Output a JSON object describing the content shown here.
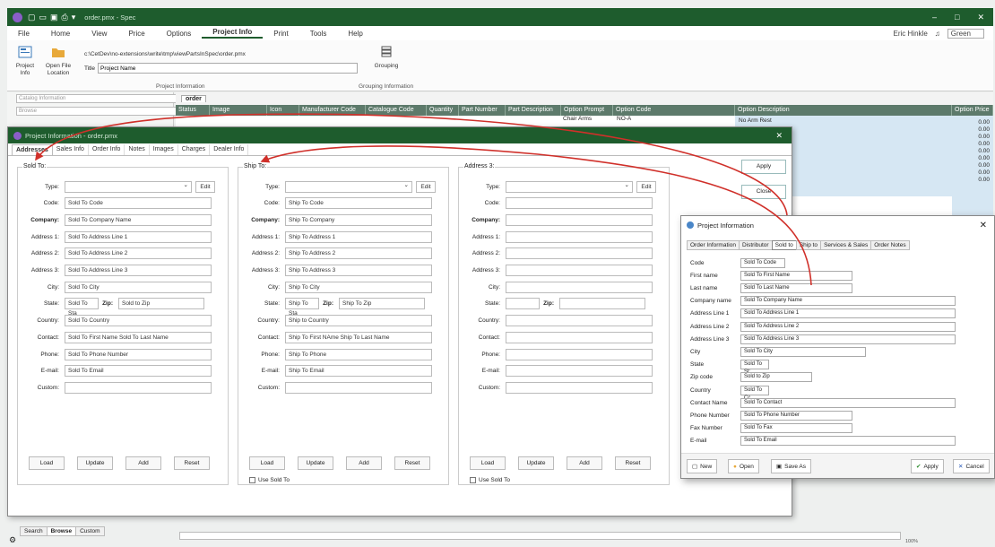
{
  "app": {
    "title": "order.pmx - Spec"
  },
  "menu": {
    "items": [
      "File",
      "Home",
      "View",
      "Price",
      "Options",
      "Project Info",
      "Print",
      "Tools",
      "Help"
    ],
    "active": "Project Info"
  },
  "user": {
    "name": "Eric Hinkle",
    "theme": "Green"
  },
  "ribbon": {
    "project_info": "Project\nInfo",
    "open_file": "Open File\nLocation",
    "path": "c:\\CetDev\\no-extensions\\write\\tmp\\viewPartsInSpec\\order.pmx",
    "title_label": "Title",
    "title_value": "Project Name",
    "grouping": "Grouping",
    "group_project": "Project Information",
    "group_grouping": "Grouping Information"
  },
  "left": {
    "catalog": "Catalog Information",
    "browse": "Browse"
  },
  "grid": {
    "tab": "order",
    "columns": [
      "Status",
      "Image",
      "Icon",
      "Manufacturer Code",
      "Catalogue Code",
      "Quantity",
      "Part Number",
      "Part Description",
      "Option Prompt",
      "Option Code",
      "Option Description",
      "Option Price"
    ],
    "row_prompt": "Chair Arms",
    "row_code": "NO-A",
    "row_desc": "No Arm Rest",
    "prices": [
      "0.00",
      "0.00",
      "0.00",
      "0.00",
      "0.00",
      "0.00",
      "0.00",
      "0.00",
      "0.00"
    ]
  },
  "dialog": {
    "title": "Project Information - order.pmx",
    "tabs": [
      "Addresses",
      "Sales Info",
      "Order Info",
      "Notes",
      "Images",
      "Charges",
      "Dealer Info"
    ],
    "apply": "Apply",
    "close": "Close",
    "labels": {
      "type": "Type:",
      "code": "Code:",
      "company": "Company:",
      "a1": "Address 1:",
      "a2": "Address 2:",
      "a3": "Address 3:",
      "city": "City:",
      "state": "State:",
      "zip": "Zip:",
      "country": "Country:",
      "contact": "Contact:",
      "phone": "Phone:",
      "email": "E-mail:",
      "custom": "Custom:"
    },
    "edit": "Edit",
    "load": "Load",
    "update": "Update",
    "add": "Add",
    "reset": "Reset",
    "use_sold_to": "Use Sold To",
    "sold": {
      "title": "Sold To:",
      "code": "Sold To Code",
      "company": "Sold To Company Name",
      "a1": "Sold To Address Line 1",
      "a2": "Sold To Address Line 2",
      "a3": "Sold To Address Line 3",
      "city": "Sold To City",
      "state": "Sold To Sta",
      "zip": "Sold to Zip",
      "country": "Sold To Country",
      "contact": "Sold To First Name Sold To Last Name",
      "phone": "Sold To Phone Number",
      "email": "Sold To Email"
    },
    "ship": {
      "title": "Ship To:",
      "code": "Ship To Code",
      "company": "Ship To Company",
      "a1": "Ship To Address 1",
      "a2": "Ship To Address 2",
      "a3": "Ship To Address 3",
      "city": "Ship To City",
      "state": "Ship To Sta",
      "zip": "Ship To Zip",
      "country": "Ship to Country",
      "contact": "Ship To First NAme Ship To Last Name",
      "phone": "Ship To Phone",
      "email": "Ship To Email"
    },
    "addr3": {
      "title": "Address 3:"
    }
  },
  "dialog2": {
    "title": "Project Information",
    "tabs": [
      "Order Information",
      "Distributor",
      "Sold to",
      "Ship to",
      "Services & Sales",
      "Order Notes"
    ],
    "rows": [
      [
        "Code",
        "Sold To Code"
      ],
      [
        "First name",
        "Sold To First Name"
      ],
      [
        "Last name",
        "Sold To Last Name"
      ],
      [
        "Company name",
        "Sold To Company Name"
      ],
      [
        "Address Line 1",
        "Sold To Address Line 1"
      ],
      [
        "Address Line 2",
        "Sold To Address Line 2"
      ],
      [
        "Address Line 3",
        "Sold To Address Line 3"
      ],
      [
        "City",
        "Sold To City"
      ],
      [
        "State",
        "Sold To St:"
      ],
      [
        "Zip code",
        "Sold to Zip"
      ],
      [
        "Country",
        "Sold To Cc"
      ],
      [
        "Contact Name",
        "Sold To Contact"
      ],
      [
        "Phone Number",
        "Sold To Phone Number"
      ],
      [
        "Fax Number",
        "Sold To Fax"
      ],
      [
        "E-mail",
        "Sold To Email"
      ]
    ],
    "new": "New",
    "open": "Open",
    "save_as": "Save As",
    "apply": "Apply",
    "cancel": "Cancel"
  },
  "bottom": {
    "tabs": [
      "Search",
      "Browse",
      "Custom"
    ],
    "zoom": "100%"
  },
  "colors": {
    "titlebar": "#1e5c2d",
    "arrow": "#d0302a",
    "selection": "#d6e7f3"
  }
}
